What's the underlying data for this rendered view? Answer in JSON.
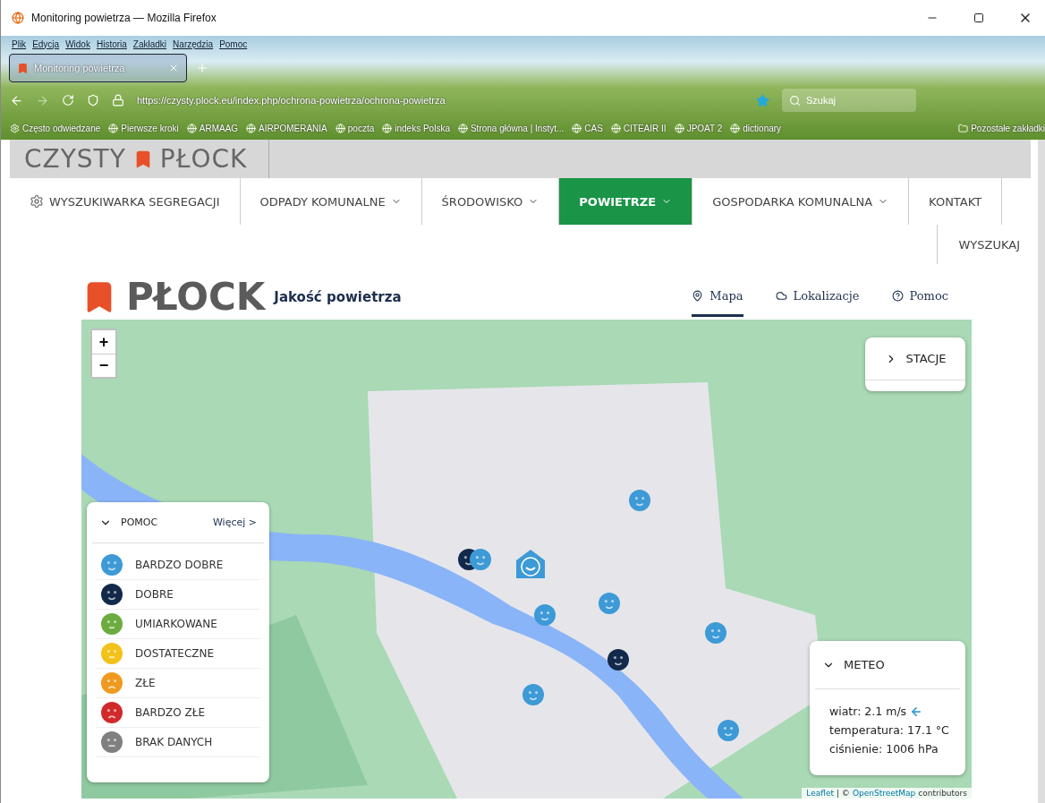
{
  "window": {
    "title": "Monitoring powietrza — Mozilla Firefox"
  },
  "menu": [
    "Plik",
    "Edycja",
    "Widok",
    "Historia",
    "Zakładki",
    "Narzędzia",
    "Pomoc"
  ],
  "tabs": [
    {
      "label": "Monitoring powietrza",
      "selected": true
    }
  ],
  "address": {
    "url": "https://czysty.plock.eu/index.php/ochrona-powietrza/ochrona-powietrza"
  },
  "search": {
    "placeholder": "Szukaj"
  },
  "bookmarks": [
    "Często odwiedzane",
    "Pierwsze kroki",
    "ARMAAG",
    "AIRPOMERANIA",
    "poczta",
    "indeks Polska",
    "Strona główna | Instyt...",
    "CAS",
    "CITEAIR II",
    "JPOAT 2",
    "dictionary"
  ],
  "other_bookmarks": "Pozostałe zakładki",
  "site": {
    "logo_left": "CZYSTY",
    "logo_right": "PŁOCK",
    "nav": [
      {
        "label": "WYSZUKIWARKA SEGREGACJI",
        "dropdown": false,
        "selected": false
      },
      {
        "label": "ODPADY KOMUNALNE",
        "dropdown": true,
        "selected": false
      },
      {
        "label": "ŚRODOWISKO",
        "dropdown": true,
        "selected": false
      },
      {
        "label": "POWIETRZE",
        "dropdown": true,
        "selected": true
      },
      {
        "label": "GOSPODARKA KOMUNALNA",
        "dropdown": true,
        "selected": false
      },
      {
        "label": "KONTAKT",
        "dropdown": false,
        "selected": false
      }
    ],
    "search_link": "WYSZUKAJ"
  },
  "app": {
    "logo": "PŁOCK",
    "title": "Jakość powietrza",
    "tabs": [
      {
        "label": "Mapa",
        "selected": true
      },
      {
        "label": "Lokalizacje",
        "selected": false
      },
      {
        "label": "Pomoc",
        "selected": false
      }
    ]
  },
  "map": {
    "zoom_in": "+",
    "zoom_out": "−",
    "stations": "STACJE",
    "legend": {
      "title": "POMOC",
      "more": "Więcej >",
      "items": [
        {
          "label": "BARDZO DOBRE",
          "color": "#3d9ad6",
          "kind": "smile"
        },
        {
          "label": "DOBRE",
          "color": "#13294b",
          "kind": "smile"
        },
        {
          "label": "UMIARKOWANE",
          "color": "#6bab3f",
          "kind": "neutral"
        },
        {
          "label": "DOSTATECZNE",
          "color": "#f2c21b",
          "kind": "neutral"
        },
        {
          "label": "ZŁE",
          "color": "#ef9a1f",
          "kind": "frown"
        },
        {
          "label": "BARDZO ZŁE",
          "color": "#d12a2a",
          "kind": "frown"
        },
        {
          "label": "BRAK DANYCH",
          "color": "#808080",
          "kind": "flat"
        }
      ]
    },
    "meteo": {
      "title": "METEO",
      "wind": "wiatr: 2.1 m/s",
      "temperature": "temperatura: 17.1 °C",
      "pressure": "ciśnienie: 1006 hPa"
    },
    "markers": [
      {
        "color": "#3d9ad6",
        "kind": "circle"
      },
      {
        "color": "#13294b",
        "kind": "circle"
      },
      {
        "color": "#3d9ad6",
        "kind": "circle"
      },
      {
        "color": "#3d9ad6",
        "kind": "home"
      },
      {
        "color": "#3d9ad6",
        "kind": "circle"
      },
      {
        "color": "#3d9ad6",
        "kind": "circle"
      },
      {
        "color": "#3d9ad6",
        "kind": "circle"
      },
      {
        "color": "#13294b",
        "kind": "circle"
      },
      {
        "color": "#3d9ad6",
        "kind": "circle"
      },
      {
        "color": "#3d9ad6",
        "kind": "circle"
      }
    ],
    "attribution": {
      "leaflet": "Leaflet",
      "separator": "| ©",
      "osm": "OpenStreetMap",
      "suffix": "contributors"
    }
  }
}
